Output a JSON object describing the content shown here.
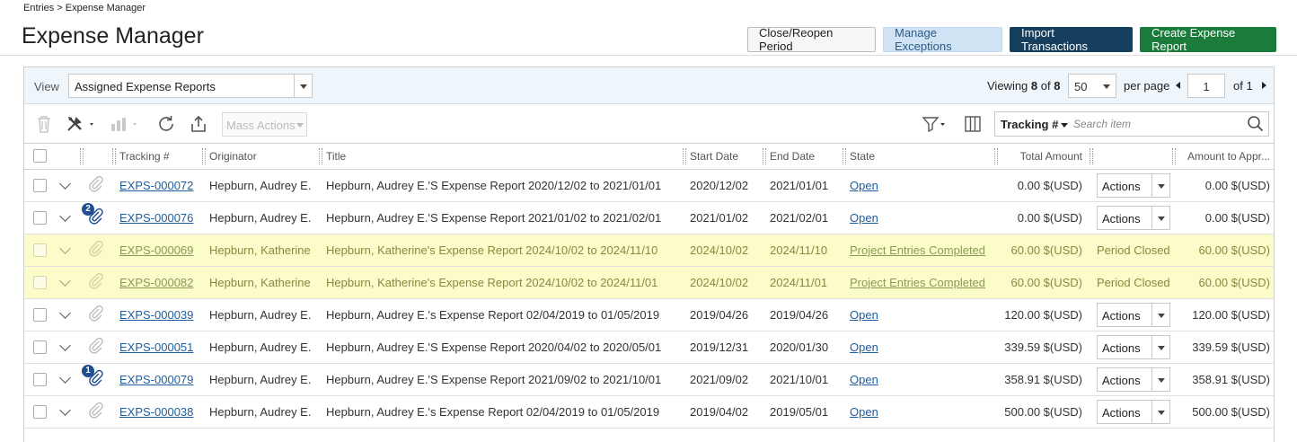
{
  "breadcrumb": "Entries > Expense Manager",
  "page_title": "Expense Manager",
  "top_buttons": {
    "close_reopen": "Close/Reopen Period",
    "manage_exceptions": "Manage Exceptions",
    "import_transactions": "Import Transactions",
    "create_report": "Create Expense Report"
  },
  "viewbar": {
    "view_label": "View",
    "view_value": "Assigned Expense Reports",
    "viewing_prefix": "Viewing",
    "viewing_count": "8",
    "viewing_of": "of",
    "viewing_total": "8",
    "per_page_value": "50",
    "per_page_label": "per page",
    "page_value": "1",
    "of_pages": "of 1"
  },
  "toolbar": {
    "mass_actions": "Mass Actions",
    "search_field": "Tracking #",
    "search_placeholder": "Search item"
  },
  "columns": {
    "tracking": "Tracking #",
    "originator": "Originator",
    "title": "Title",
    "start": "Start Date",
    "end": "End Date",
    "state": "State",
    "total": "Total Amount",
    "approve": "Amount to Appr..."
  },
  "rows": [
    {
      "tracking": "EXPS-000072",
      "badge": "",
      "originator": "Hepburn, Audrey E.",
      "title": "Hepburn, Audrey E.'S Expense Report 2020/12/02 to 2021/01/01",
      "start": "2020/12/02",
      "end": "2021/01/01",
      "state": "Open",
      "total": "0.00 $(USD)",
      "action": "Actions",
      "approve": "0.00 $(USD)",
      "highlight": false
    },
    {
      "tracking": "EXPS-000076",
      "badge": "2",
      "originator": "Hepburn, Audrey E.",
      "title": "Hepburn, Audrey E.'S Expense Report 2021/01/02 to 2021/02/01",
      "start": "2021/01/02",
      "end": "2021/02/01",
      "state": "Open",
      "total": "0.00 $(USD)",
      "action": "Actions",
      "approve": "0.00 $(USD)",
      "highlight": false
    },
    {
      "tracking": "EXPS-000069",
      "badge": "",
      "originator": "Hepburn, Katherine",
      "title": "Hepburn, Katherine's Expense Report 2024/10/02 to 2024/11/10",
      "start": "2024/10/02",
      "end": "2024/11/10",
      "state": "Project Entries Completed",
      "total": "60.00 $(USD)",
      "action": "Period Closed",
      "approve": "60.00 $(USD)",
      "highlight": true
    },
    {
      "tracking": "EXPS-000082",
      "badge": "",
      "originator": "Hepburn, Katherine",
      "title": "Hepburn, Katherine's Expense Report 2024/10/02 to 2024/11/01",
      "start": "2024/10/02",
      "end": "2024/11/01",
      "state": "Project Entries Completed",
      "total": "60.00 $(USD)",
      "action": "Period Closed",
      "approve": "60.00 $(USD)",
      "highlight": true
    },
    {
      "tracking": "EXPS-000039",
      "badge": "",
      "originator": "Hepburn, Audrey E.",
      "title": "Hepburn, Audrey E.'s Expense Report 02/04/2019 to 01/05/2019",
      "start": "2019/04/26",
      "end": "2019/04/26",
      "state": "Open",
      "total": "120.00 $(USD)",
      "action": "Actions",
      "approve": "120.00 $(USD)",
      "highlight": false
    },
    {
      "tracking": "EXPS-000051",
      "badge": "",
      "originator": "Hepburn, Audrey E.",
      "title": "Hepburn, Audrey E.'S Expense Report 2020/04/02 to 2020/05/01",
      "start": "2019/12/31",
      "end": "2020/01/30",
      "state": "Open",
      "total": "339.59 $(USD)",
      "action": "Actions",
      "approve": "339.59 $(USD)",
      "highlight": false
    },
    {
      "tracking": "EXPS-000079",
      "badge": "1",
      "originator": "Hepburn, Audrey E.",
      "title": "Hepburn, Audrey E.'S Expense Report 2021/09/02 to 2021/10/01",
      "start": "2021/09/02",
      "end": "2021/10/01",
      "state": "Open",
      "total": "358.91 $(USD)",
      "action": "Actions",
      "approve": "358.91 $(USD)",
      "highlight": false
    },
    {
      "tracking": "EXPS-000038",
      "badge": "",
      "originator": "Hepburn, Audrey E.",
      "title": "Hepburn, Audrey E.'s Expense Report 02/04/2019 to 01/05/2019",
      "start": "2019/04/02",
      "end": "2019/05/01",
      "state": "Open",
      "total": "500.00 $(USD)",
      "action": "Actions",
      "approve": "500.00 $(USD)",
      "highlight": false
    }
  ]
}
